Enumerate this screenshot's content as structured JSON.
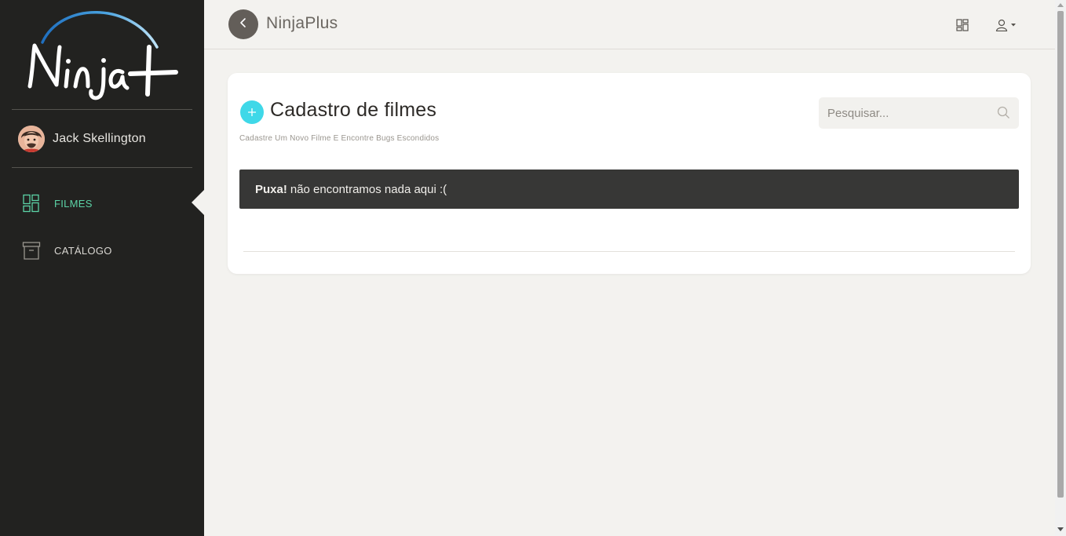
{
  "sidebar": {
    "logo_text": "Ninja+",
    "user": {
      "name": "Jack Skellington"
    },
    "nav": [
      {
        "label": "FILMES",
        "icon": "dashboard-icon",
        "active": true
      },
      {
        "label": "CATÁLOGO",
        "icon": "archive-box-icon",
        "active": false
      }
    ]
  },
  "header": {
    "brand": "NinjaPlus",
    "icons": [
      "back-arrow-icon",
      "grid-view-icon",
      "user-dropdown-icon"
    ]
  },
  "main": {
    "title": "Cadastro de filmes",
    "subtitle": "Cadastre Um Novo Filme E Encontre Bugs Escondidos",
    "search": {
      "placeholder": "Pesquisar...",
      "value": ""
    },
    "alert": {
      "bold": "Puxa!",
      "text": "não encontramos nada aqui :("
    }
  },
  "colors": {
    "sidebar_bg": "#222220",
    "active_nav": "#5cd3a6",
    "add_button": "#3fd8e8",
    "alert_bg": "#373736",
    "page_bg": "#f3f2ef"
  }
}
